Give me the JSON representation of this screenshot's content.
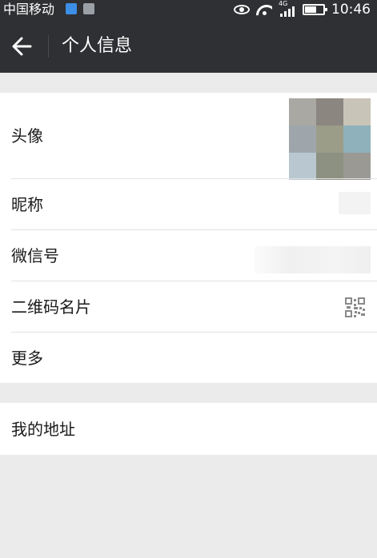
{
  "status_bar": {
    "carrier": "中国移动",
    "network": "4G",
    "time": "10:46"
  },
  "header": {
    "title": "个人信息"
  },
  "profile": {
    "avatar_label": "头像",
    "nickname_label": "昵称",
    "wechat_id_label": "微信号",
    "qr_code_label": "二维码名片",
    "more_label": "更多"
  },
  "address": {
    "label": "我的地址"
  },
  "colors": {
    "header_bg": "#2f3033",
    "page_bg": "#ebebeb",
    "row_bg": "#ffffff",
    "separator": "#e1e1e1"
  }
}
